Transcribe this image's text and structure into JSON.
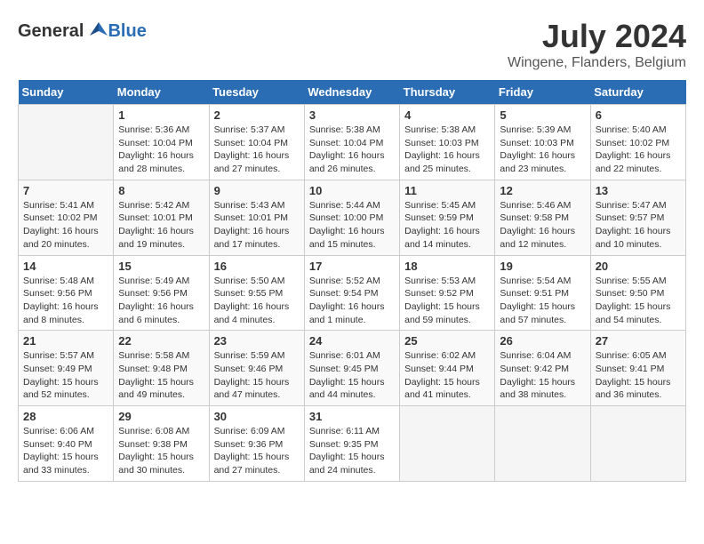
{
  "header": {
    "logo_general": "General",
    "logo_blue": "Blue",
    "month_year": "July 2024",
    "location": "Wingene, Flanders, Belgium"
  },
  "days_of_week": [
    "Sunday",
    "Monday",
    "Tuesday",
    "Wednesday",
    "Thursday",
    "Friday",
    "Saturday"
  ],
  "weeks": [
    [
      {
        "day": "",
        "info": ""
      },
      {
        "day": "1",
        "info": "Sunrise: 5:36 AM\nSunset: 10:04 PM\nDaylight: 16 hours\nand 28 minutes."
      },
      {
        "day": "2",
        "info": "Sunrise: 5:37 AM\nSunset: 10:04 PM\nDaylight: 16 hours\nand 27 minutes."
      },
      {
        "day": "3",
        "info": "Sunrise: 5:38 AM\nSunset: 10:04 PM\nDaylight: 16 hours\nand 26 minutes."
      },
      {
        "day": "4",
        "info": "Sunrise: 5:38 AM\nSunset: 10:03 PM\nDaylight: 16 hours\nand 25 minutes."
      },
      {
        "day": "5",
        "info": "Sunrise: 5:39 AM\nSunset: 10:03 PM\nDaylight: 16 hours\nand 23 minutes."
      },
      {
        "day": "6",
        "info": "Sunrise: 5:40 AM\nSunset: 10:02 PM\nDaylight: 16 hours\nand 22 minutes."
      }
    ],
    [
      {
        "day": "7",
        "info": "Sunrise: 5:41 AM\nSunset: 10:02 PM\nDaylight: 16 hours\nand 20 minutes."
      },
      {
        "day": "8",
        "info": "Sunrise: 5:42 AM\nSunset: 10:01 PM\nDaylight: 16 hours\nand 19 minutes."
      },
      {
        "day": "9",
        "info": "Sunrise: 5:43 AM\nSunset: 10:01 PM\nDaylight: 16 hours\nand 17 minutes."
      },
      {
        "day": "10",
        "info": "Sunrise: 5:44 AM\nSunset: 10:00 PM\nDaylight: 16 hours\nand 15 minutes."
      },
      {
        "day": "11",
        "info": "Sunrise: 5:45 AM\nSunset: 9:59 PM\nDaylight: 16 hours\nand 14 minutes."
      },
      {
        "day": "12",
        "info": "Sunrise: 5:46 AM\nSunset: 9:58 PM\nDaylight: 16 hours\nand 12 minutes."
      },
      {
        "day": "13",
        "info": "Sunrise: 5:47 AM\nSunset: 9:57 PM\nDaylight: 16 hours\nand 10 minutes."
      }
    ],
    [
      {
        "day": "14",
        "info": "Sunrise: 5:48 AM\nSunset: 9:56 PM\nDaylight: 16 hours\nand 8 minutes."
      },
      {
        "day": "15",
        "info": "Sunrise: 5:49 AM\nSunset: 9:56 PM\nDaylight: 16 hours\nand 6 minutes."
      },
      {
        "day": "16",
        "info": "Sunrise: 5:50 AM\nSunset: 9:55 PM\nDaylight: 16 hours\nand 4 minutes."
      },
      {
        "day": "17",
        "info": "Sunrise: 5:52 AM\nSunset: 9:54 PM\nDaylight: 16 hours\nand 1 minute."
      },
      {
        "day": "18",
        "info": "Sunrise: 5:53 AM\nSunset: 9:52 PM\nDaylight: 15 hours\nand 59 minutes."
      },
      {
        "day": "19",
        "info": "Sunrise: 5:54 AM\nSunset: 9:51 PM\nDaylight: 15 hours\nand 57 minutes."
      },
      {
        "day": "20",
        "info": "Sunrise: 5:55 AM\nSunset: 9:50 PM\nDaylight: 15 hours\nand 54 minutes."
      }
    ],
    [
      {
        "day": "21",
        "info": "Sunrise: 5:57 AM\nSunset: 9:49 PM\nDaylight: 15 hours\nand 52 minutes."
      },
      {
        "day": "22",
        "info": "Sunrise: 5:58 AM\nSunset: 9:48 PM\nDaylight: 15 hours\nand 49 minutes."
      },
      {
        "day": "23",
        "info": "Sunrise: 5:59 AM\nSunset: 9:46 PM\nDaylight: 15 hours\nand 47 minutes."
      },
      {
        "day": "24",
        "info": "Sunrise: 6:01 AM\nSunset: 9:45 PM\nDaylight: 15 hours\nand 44 minutes."
      },
      {
        "day": "25",
        "info": "Sunrise: 6:02 AM\nSunset: 9:44 PM\nDaylight: 15 hours\nand 41 minutes."
      },
      {
        "day": "26",
        "info": "Sunrise: 6:04 AM\nSunset: 9:42 PM\nDaylight: 15 hours\nand 38 minutes."
      },
      {
        "day": "27",
        "info": "Sunrise: 6:05 AM\nSunset: 9:41 PM\nDaylight: 15 hours\nand 36 minutes."
      }
    ],
    [
      {
        "day": "28",
        "info": "Sunrise: 6:06 AM\nSunset: 9:40 PM\nDaylight: 15 hours\nand 33 minutes."
      },
      {
        "day": "29",
        "info": "Sunrise: 6:08 AM\nSunset: 9:38 PM\nDaylight: 15 hours\nand 30 minutes."
      },
      {
        "day": "30",
        "info": "Sunrise: 6:09 AM\nSunset: 9:36 PM\nDaylight: 15 hours\nand 27 minutes."
      },
      {
        "day": "31",
        "info": "Sunrise: 6:11 AM\nSunset: 9:35 PM\nDaylight: 15 hours\nand 24 minutes."
      },
      {
        "day": "",
        "info": ""
      },
      {
        "day": "",
        "info": ""
      },
      {
        "day": "",
        "info": ""
      }
    ]
  ]
}
